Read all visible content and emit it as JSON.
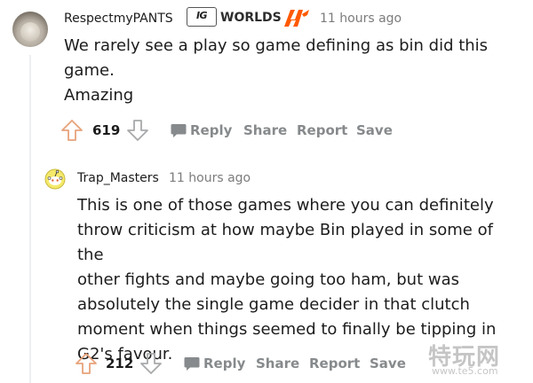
{
  "comments": [
    {
      "author": "RespectmyPANTS",
      "flair_badge": "IG",
      "flair_text": "WORLDS",
      "time": "11 hours ago",
      "body": [
        "We rarely see a play so game defining as bin did this",
        "game.",
        "Amazing"
      ],
      "score": "619",
      "actions": {
        "reply": "Reply",
        "share": "Share",
        "report": "Report",
        "save": "Save"
      }
    },
    {
      "author": "Trap_Masters",
      "time": "11 hours ago",
      "body": [
        "This is one of those games where you can definitely",
        "throw criticism at how maybe Bin played in some of the",
        "other fights and maybe going too ham, but was",
        "absolutely the single game decider in that clutch",
        "moment when things seemed to finally be tipping in",
        "G2's favour."
      ],
      "score": "212",
      "actions": {
        "reply": "Reply",
        "share": "Share",
        "report": "Report",
        "save": "Save"
      }
    }
  ],
  "watermark": {
    "title": "特玩网",
    "url": "www.te5.com"
  },
  "colors": {
    "upvote": "#e8a27a",
    "downvote": "#a7a9ab",
    "action": "#878a8c",
    "meta": "#7c7c7c",
    "fnatic": "#ff5900"
  }
}
